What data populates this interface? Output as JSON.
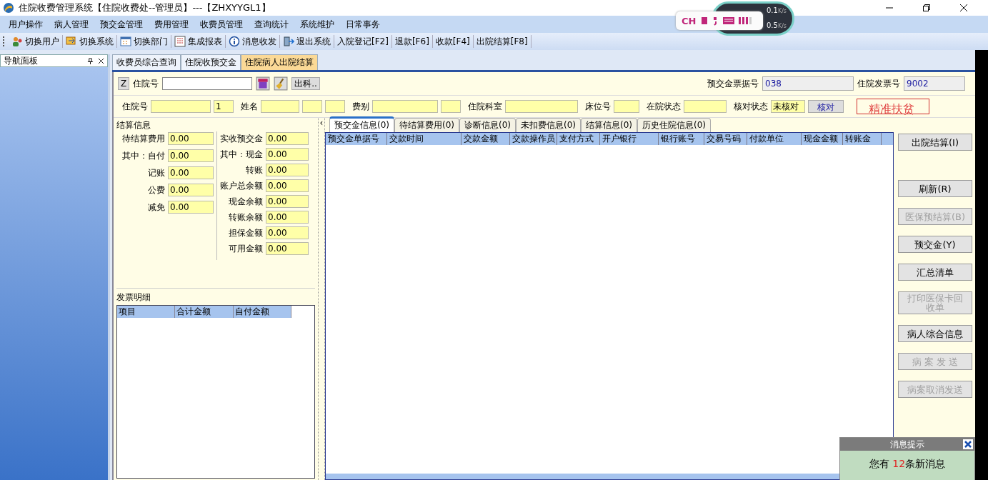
{
  "window": {
    "title": "住院收费管理系统【住院收费处--管理员】---【ZHXYYGL1】"
  },
  "menu": [
    "用户操作",
    "病人管理",
    "预交金管理",
    "费用管理",
    "收费员管理",
    "查询统计",
    "系统维护",
    "日常事务"
  ],
  "toolbar": {
    "with_icon": [
      "切换用户",
      "切换系统",
      "切换部门",
      "集成报表",
      "消息收发",
      "退出系统"
    ],
    "shortcuts": [
      "入院登记[F2]",
      "退款[F6]",
      "收款[F4]",
      "出院结算[F8]"
    ]
  },
  "ime_bar": {
    "language": "CH",
    "upload": "0.1",
    "download": "0.5",
    "upload_unit": "K/s",
    "download_unit": "K/s"
  },
  "splitter": {
    "glyph": "‹"
  },
  "nav_panel": {
    "title": "导航面板"
  },
  "doc_tabs": [
    {
      "label": "收费员综合查询",
      "selected": false
    },
    {
      "label": "住院收预交金",
      "selected": false
    },
    {
      "label": "住院病人出院结算",
      "selected": true
    }
  ],
  "search": {
    "z_button": "Z",
    "label": "住院号",
    "discharge_button": "出科..",
    "receipt_label": "预交金票据号",
    "receipt_no": "038",
    "invoice_label": "住院发票号",
    "invoice_no": "9002"
  },
  "patient_row": [
    {
      "kind": "label",
      "text": "住院号"
    },
    {
      "kind": "field"
    },
    {
      "kind": "field",
      "value": "1"
    },
    {
      "kind": "label",
      "text": "姓名"
    },
    {
      "kind": "field"
    },
    {
      "kind": "field"
    },
    {
      "kind": "field"
    },
    {
      "kind": "label",
      "text": "费别"
    },
    {
      "kind": "field"
    },
    {
      "kind": "field"
    },
    {
      "kind": "label",
      "text": "住院科室"
    },
    {
      "kind": "field"
    },
    {
      "kind": "label",
      "text": "床位号"
    },
    {
      "kind": "field"
    },
    {
      "kind": "label",
      "text": "在院状态"
    },
    {
      "kind": "field"
    },
    {
      "kind": "label",
      "text": "核对状态"
    },
    {
      "kind": "field",
      "value": "未核对"
    },
    {
      "kind": "button",
      "text": "核对"
    },
    {
      "kind": "stamp",
      "text": "精准扶贫"
    }
  ],
  "settlement": {
    "title": "结算信息",
    "left": [
      {
        "label": "待结算费用",
        "value": "0.00"
      },
      {
        "label": "其中：自付",
        "value": "0.00"
      },
      {
        "label": "记账",
        "value": "0.00"
      },
      {
        "label": "公费",
        "value": "0.00"
      },
      {
        "label": "减免",
        "value": "0.00"
      }
    ],
    "right": [
      {
        "label": "实收预交金",
        "value": "0.00"
      },
      {
        "label": "其中：现金",
        "value": "0.00"
      },
      {
        "label": "转账",
        "value": "0.00"
      },
      {
        "label": "账户总余额",
        "value": "0.00"
      },
      {
        "label": "现金余额",
        "value": "0.00"
      },
      {
        "label": "转账余额",
        "value": "0.00"
      },
      {
        "label": "担保金额",
        "value": "0.00"
      },
      {
        "label": "可用金额",
        "value": "0.00"
      }
    ]
  },
  "invoice": {
    "title": "发票明细",
    "columns": [
      "项目",
      "合计金额",
      "自付金额"
    ]
  },
  "detail_tabs": [
    {
      "label": "预交金信息(0)",
      "selected": true
    },
    {
      "label": "待结算费用(0)",
      "selected": false
    },
    {
      "label": "诊断信息(0)",
      "selected": false
    },
    {
      "label": "未扣费信息(0)",
      "selected": false
    },
    {
      "label": "结算信息(0)",
      "selected": false
    },
    {
      "label": "历史住院信息(0)",
      "selected": false
    }
  ],
  "detail_columns": [
    "预交金单据号",
    "交款时间",
    "交款金额",
    "交款操作员",
    "支付方式",
    "开户银行",
    "银行账号",
    "交易号码",
    "付款单位",
    "现金金额",
    "转账金"
  ],
  "actions": [
    {
      "label": "出院结算(I)",
      "disabled": false
    },
    {
      "label": "刷新(R)",
      "disabled": false
    },
    {
      "label": "医保预结算(B)",
      "disabled": true
    },
    {
      "label": "预交金(Y)",
      "disabled": false
    },
    {
      "label": "汇总清单",
      "disabled": false
    },
    {
      "label": "打印医保卡回收单",
      "disabled": true
    },
    {
      "label": "病人综合信息",
      "disabled": false
    },
    {
      "label": "病 案 发 送",
      "disabled": true
    },
    {
      "label": "病案取消发送",
      "disabled": true
    }
  ],
  "message": {
    "title": "消息提示",
    "prefix": "您有",
    "count": "12",
    "suffix": "条新消息"
  }
}
